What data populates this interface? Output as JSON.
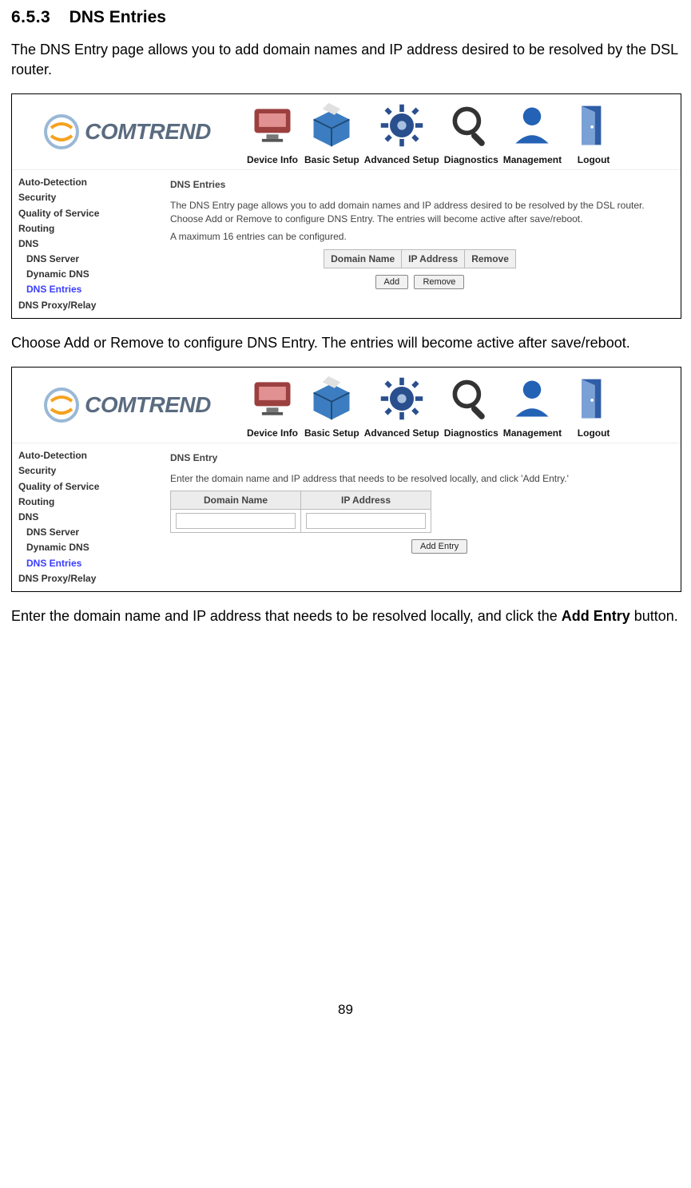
{
  "section": {
    "number": "6.5.3",
    "title": "DNS Entries"
  },
  "paragraphs": {
    "p1": "The DNS Entry page allows you to add domain names and IP address desired to be resolved by the DSL router.",
    "p2": "Choose Add or Remove to configure DNS Entry. The entries will become active after save/reboot.",
    "p3_pre": "Enter the domain name and IP address that needs to be resolved locally, and click the ",
    "p3_bold": "Add Entry",
    "p3_post": " button."
  },
  "page_number": "89",
  "brand": "COMTREND",
  "topnav": [
    {
      "label": "Device Info"
    },
    {
      "label": "Basic Setup"
    },
    {
      "label": "Advanced Setup"
    },
    {
      "label": "Diagnostics"
    },
    {
      "label": "Management"
    },
    {
      "label": "Logout"
    }
  ],
  "sidebar": {
    "items": [
      {
        "label": "Auto-Detection",
        "level": 1,
        "active": false
      },
      {
        "label": "Security",
        "level": 1,
        "active": false
      },
      {
        "label": "Quality of Service",
        "level": 1,
        "active": false
      },
      {
        "label": "Routing",
        "level": 1,
        "active": false
      },
      {
        "label": "DNS",
        "level": 1,
        "active": false
      },
      {
        "label": "DNS Server",
        "level": 2,
        "active": false
      },
      {
        "label": "Dynamic DNS",
        "level": 2,
        "active": false
      },
      {
        "label": "DNS Entries",
        "level": 2,
        "active": true
      },
      {
        "label": "DNS Proxy/Relay",
        "level": 1,
        "active": false
      }
    ]
  },
  "panel1": {
    "content_title": "DNS Entries",
    "desc": "The DNS Entry page allows you to add domain names and IP address desired to be resolved by the DSL router. Choose Add or Remove to configure DNS Entry. The entries will become active after save/reboot.",
    "limit": "A maximum 16 entries can be configured.",
    "table_headers": [
      "Domain Name",
      "IP Address",
      "Remove"
    ],
    "buttons": {
      "add": "Add",
      "remove": "Remove"
    }
  },
  "panel2": {
    "content_title": "DNS Entry",
    "desc": "Enter the domain name and IP address that needs to be resolved locally, and click 'Add Entry.'",
    "table_headers": [
      "Domain Name",
      "IP Address"
    ],
    "inputs": {
      "domain": "",
      "ip": ""
    },
    "buttons": {
      "add_entry": "Add Entry"
    }
  }
}
